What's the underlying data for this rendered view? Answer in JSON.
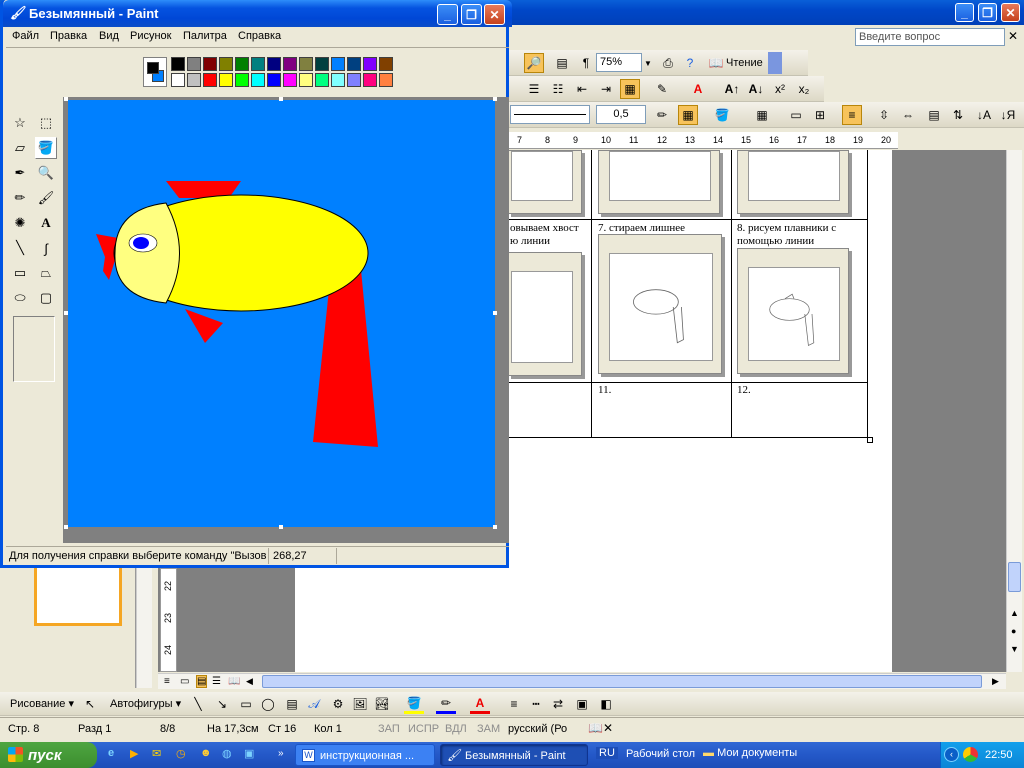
{
  "word": {
    "ask_placeholder": "Введите вопрос",
    "zoom": "75%",
    "reading_label": "Чтение",
    "line_weight": "0,5",
    "ruler_ticks": [
      "7",
      "8",
      "9",
      "10",
      "11",
      "12",
      "13",
      "14",
      "15",
      "16",
      "17",
      "18",
      "19",
      "20"
    ],
    "table": {
      "row2": {
        "c1": "овываем хвост",
        "c1b": "ю линии",
        "c2": "7.   стираем лишнее",
        "c3": "8.   рисуем плавники с",
        "c3b": "помощью линии"
      },
      "row3": {
        "c2": "11.",
        "c3": "12."
      }
    },
    "left_ruler": [
      "22",
      "23",
      "24"
    ],
    "drawbar": {
      "drawing_label": "Рисование",
      "autoshapes_label": "Автофигуры"
    },
    "status": {
      "page": "Стр. 8",
      "section": "Разд 1",
      "pages": "8/8",
      "at": "На 17,3см",
      "line": "Ст 16",
      "col": "Кол 1",
      "rec": "ЗАП",
      "trk": "ИСПР",
      "ext": "ВДЛ",
      "ovr": "ЗАМ",
      "lang": "русский (Ро"
    }
  },
  "paint": {
    "title": "Безымянный - Paint",
    "menu": [
      "Файл",
      "Правка",
      "Вид",
      "Рисунок",
      "Палитра",
      "Справка"
    ],
    "status_help": "Для получения справки выберите команду \"Вызов",
    "status_coords": "268,27",
    "foreground_color": "#000000",
    "background_color": "#0080ff",
    "palette_top": [
      "#000000",
      "#808080",
      "#800000",
      "#808000",
      "#008000",
      "#008080",
      "#000080",
      "#800080",
      "#808040",
      "#004040",
      "#0080ff",
      "#004080",
      "#8000ff",
      "#804000"
    ],
    "palette_bottom": [
      "#ffffff",
      "#c0c0c0",
      "#ff0000",
      "#ffff00",
      "#00ff00",
      "#00ffff",
      "#0000ff",
      "#ff00ff",
      "#ffff80",
      "#00ff80",
      "#80ffff",
      "#8080ff",
      "#ff0080",
      "#ff8040"
    ],
    "tools": [
      "free-select",
      "rect-select",
      "eraser",
      "fill",
      "color-picker",
      "magnifier",
      "pencil",
      "brush",
      "airbrush",
      "text",
      "line",
      "curve",
      "rectangle",
      "polygon",
      "ellipse",
      "rounded-rect"
    ]
  },
  "taskbar": {
    "start_label": "пуск",
    "tasks": [
      "инструкционная ...",
      "Безымянный - Paint"
    ],
    "lang": "RU",
    "desktop": "Рабочий стол",
    "docs": "Мои документы",
    "clock": "22:50"
  }
}
